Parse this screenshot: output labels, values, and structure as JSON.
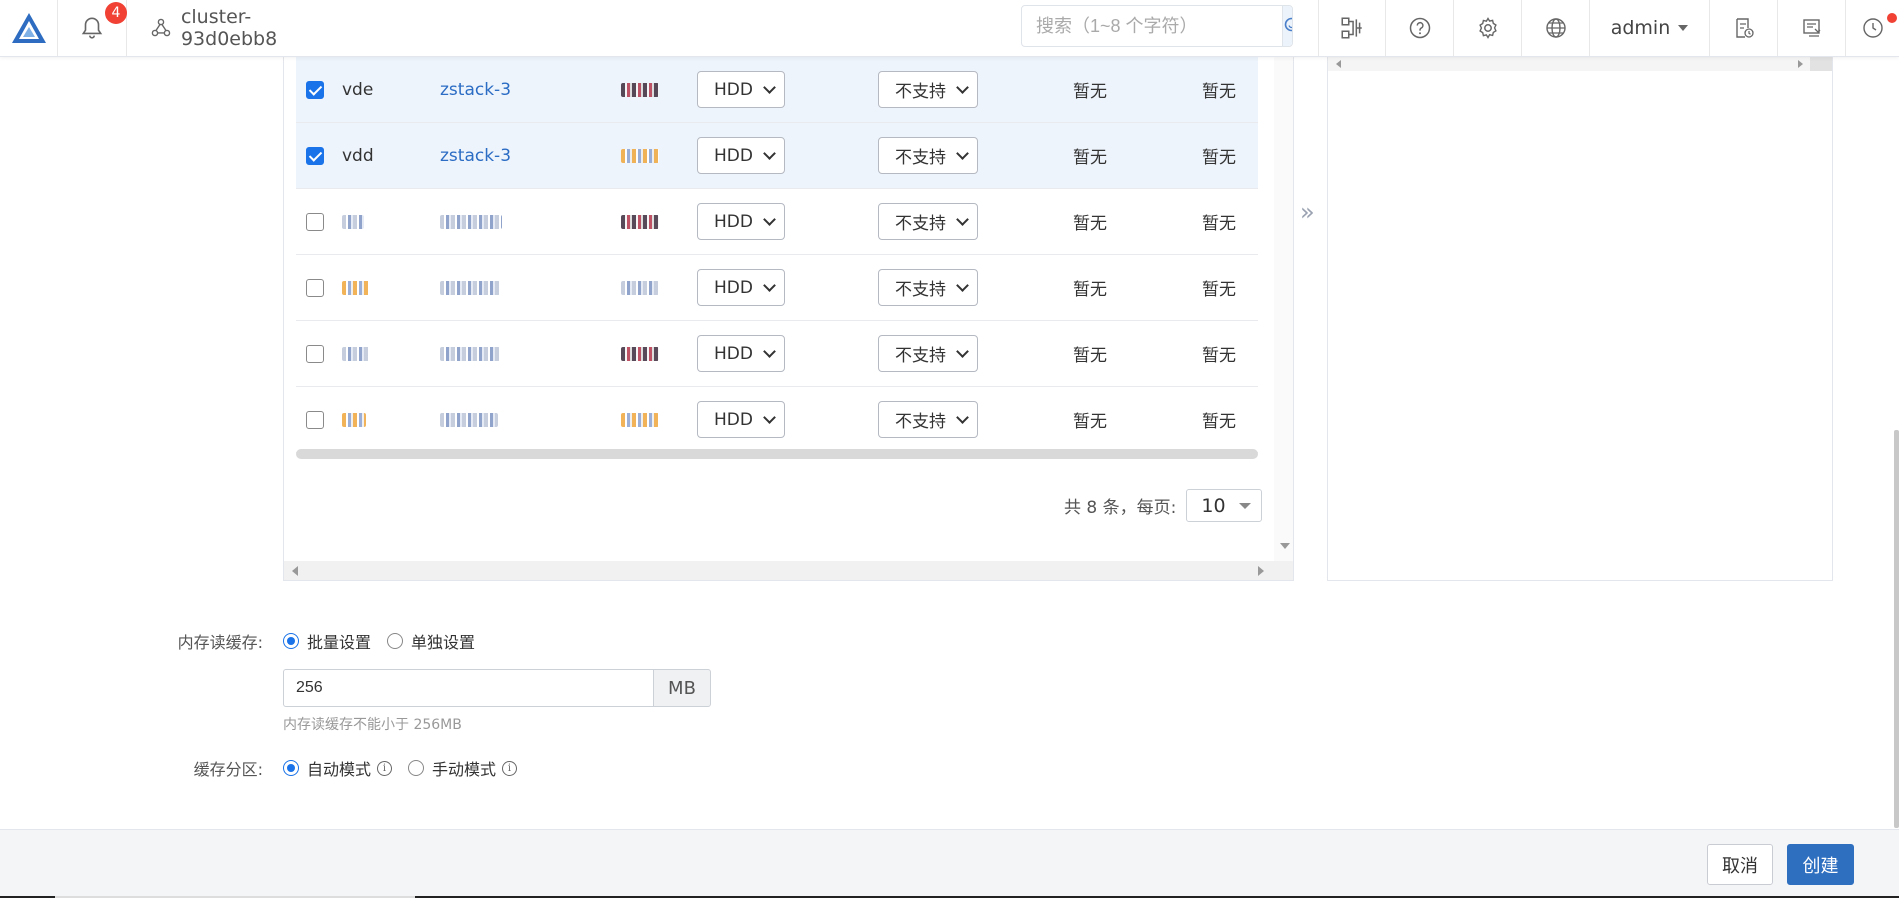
{
  "topbar": {
    "notification_count": "4",
    "cluster_name": "cluster-93d0ebb8",
    "search_placeholder": "搜索（1~8 个字符）",
    "user": "admin"
  },
  "disk_table": {
    "rows": [
      {
        "selected": true,
        "name": "vde",
        "host": "zstack-3",
        "type": "HDD",
        "feature": "不支持",
        "col7": "暂无",
        "col8": "暂无",
        "blurred": false
      },
      {
        "selected": true,
        "name": "vdd",
        "host": "zstack-3",
        "type": "HDD",
        "feature": "不支持",
        "col7": "暂无",
        "col8": "暂无",
        "blurred": false
      },
      {
        "selected": false,
        "name": "",
        "host": "",
        "type": "HDD",
        "feature": "不支持",
        "col7": "暂无",
        "col8": "暂无",
        "blurred": true
      },
      {
        "selected": false,
        "name": "",
        "host": "",
        "type": "HDD",
        "feature": "不支持",
        "col7": "暂无",
        "col8": "暂无",
        "blurred": true
      },
      {
        "selected": false,
        "name": "",
        "host": "",
        "type": "HDD",
        "feature": "不支持",
        "col7": "暂无",
        "col8": "暂无",
        "blurred": true
      },
      {
        "selected": false,
        "name": "",
        "host": "",
        "type": "HDD",
        "feature": "不支持",
        "col7": "暂无",
        "col8": "暂无",
        "blurred": true
      }
    ],
    "pagination": {
      "total_text": "共 8 条，每页:",
      "page_size": "10"
    }
  },
  "transfer_symbol": "»",
  "form": {
    "memory_cache": {
      "label": "内存读缓存:",
      "options": [
        "批量设置",
        "单独设置"
      ],
      "selected": "批量设置",
      "value": "256",
      "unit": "MB",
      "hint": "内存读缓存不能小于 256MB"
    },
    "cache_partition": {
      "label": "缓存分区:",
      "options": [
        "自动模式",
        "手动模式"
      ],
      "selected": "自动模式"
    }
  },
  "footer": {
    "cancel_label": "取消",
    "create_label": "创建"
  },
  "colors": {
    "accent": "#1a73e8",
    "primary_button": "#2f6fc0",
    "link": "#2b6cc4",
    "badge": "#f04134",
    "selected_row": "#eef4fc"
  }
}
